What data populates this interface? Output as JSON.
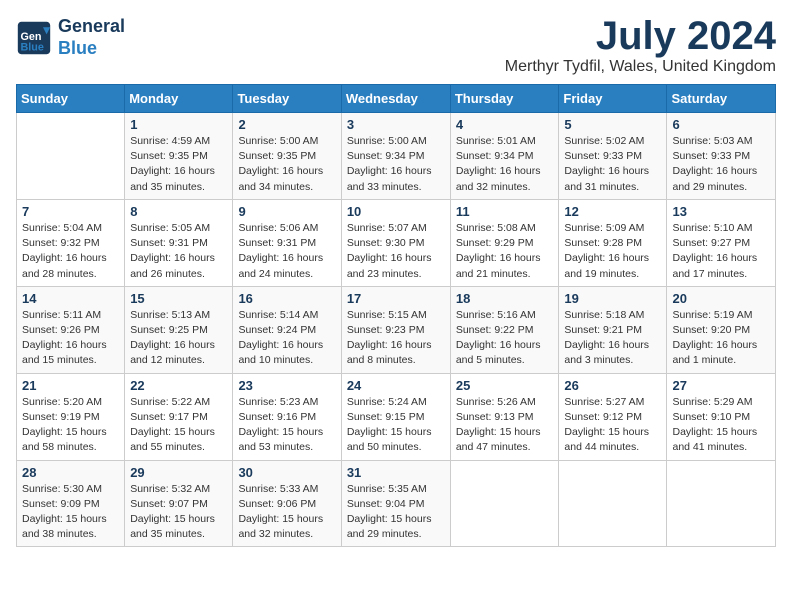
{
  "header": {
    "logo_line1": "General",
    "logo_line2": "Blue",
    "month_title": "July 2024",
    "location": "Merthyr Tydfil, Wales, United Kingdom"
  },
  "days_of_week": [
    "Sunday",
    "Monday",
    "Tuesday",
    "Wednesday",
    "Thursday",
    "Friday",
    "Saturday"
  ],
  "weeks": [
    [
      {
        "num": "",
        "detail": ""
      },
      {
        "num": "1",
        "detail": "Sunrise: 4:59 AM\nSunset: 9:35 PM\nDaylight: 16 hours\nand 35 minutes."
      },
      {
        "num": "2",
        "detail": "Sunrise: 5:00 AM\nSunset: 9:35 PM\nDaylight: 16 hours\nand 34 minutes."
      },
      {
        "num": "3",
        "detail": "Sunrise: 5:00 AM\nSunset: 9:34 PM\nDaylight: 16 hours\nand 33 minutes."
      },
      {
        "num": "4",
        "detail": "Sunrise: 5:01 AM\nSunset: 9:34 PM\nDaylight: 16 hours\nand 32 minutes."
      },
      {
        "num": "5",
        "detail": "Sunrise: 5:02 AM\nSunset: 9:33 PM\nDaylight: 16 hours\nand 31 minutes."
      },
      {
        "num": "6",
        "detail": "Sunrise: 5:03 AM\nSunset: 9:33 PM\nDaylight: 16 hours\nand 29 minutes."
      }
    ],
    [
      {
        "num": "7",
        "detail": "Sunrise: 5:04 AM\nSunset: 9:32 PM\nDaylight: 16 hours\nand 28 minutes."
      },
      {
        "num": "8",
        "detail": "Sunrise: 5:05 AM\nSunset: 9:31 PM\nDaylight: 16 hours\nand 26 minutes."
      },
      {
        "num": "9",
        "detail": "Sunrise: 5:06 AM\nSunset: 9:31 PM\nDaylight: 16 hours\nand 24 minutes."
      },
      {
        "num": "10",
        "detail": "Sunrise: 5:07 AM\nSunset: 9:30 PM\nDaylight: 16 hours\nand 23 minutes."
      },
      {
        "num": "11",
        "detail": "Sunrise: 5:08 AM\nSunset: 9:29 PM\nDaylight: 16 hours\nand 21 minutes."
      },
      {
        "num": "12",
        "detail": "Sunrise: 5:09 AM\nSunset: 9:28 PM\nDaylight: 16 hours\nand 19 minutes."
      },
      {
        "num": "13",
        "detail": "Sunrise: 5:10 AM\nSunset: 9:27 PM\nDaylight: 16 hours\nand 17 minutes."
      }
    ],
    [
      {
        "num": "14",
        "detail": "Sunrise: 5:11 AM\nSunset: 9:26 PM\nDaylight: 16 hours\nand 15 minutes."
      },
      {
        "num": "15",
        "detail": "Sunrise: 5:13 AM\nSunset: 9:25 PM\nDaylight: 16 hours\nand 12 minutes."
      },
      {
        "num": "16",
        "detail": "Sunrise: 5:14 AM\nSunset: 9:24 PM\nDaylight: 16 hours\nand 10 minutes."
      },
      {
        "num": "17",
        "detail": "Sunrise: 5:15 AM\nSunset: 9:23 PM\nDaylight: 16 hours\nand 8 minutes."
      },
      {
        "num": "18",
        "detail": "Sunrise: 5:16 AM\nSunset: 9:22 PM\nDaylight: 16 hours\nand 5 minutes."
      },
      {
        "num": "19",
        "detail": "Sunrise: 5:18 AM\nSunset: 9:21 PM\nDaylight: 16 hours\nand 3 minutes."
      },
      {
        "num": "20",
        "detail": "Sunrise: 5:19 AM\nSunset: 9:20 PM\nDaylight: 16 hours\nand 1 minute."
      }
    ],
    [
      {
        "num": "21",
        "detail": "Sunrise: 5:20 AM\nSunset: 9:19 PM\nDaylight: 15 hours\nand 58 minutes."
      },
      {
        "num": "22",
        "detail": "Sunrise: 5:22 AM\nSunset: 9:17 PM\nDaylight: 15 hours\nand 55 minutes."
      },
      {
        "num": "23",
        "detail": "Sunrise: 5:23 AM\nSunset: 9:16 PM\nDaylight: 15 hours\nand 53 minutes."
      },
      {
        "num": "24",
        "detail": "Sunrise: 5:24 AM\nSunset: 9:15 PM\nDaylight: 15 hours\nand 50 minutes."
      },
      {
        "num": "25",
        "detail": "Sunrise: 5:26 AM\nSunset: 9:13 PM\nDaylight: 15 hours\nand 47 minutes."
      },
      {
        "num": "26",
        "detail": "Sunrise: 5:27 AM\nSunset: 9:12 PM\nDaylight: 15 hours\nand 44 minutes."
      },
      {
        "num": "27",
        "detail": "Sunrise: 5:29 AM\nSunset: 9:10 PM\nDaylight: 15 hours\nand 41 minutes."
      }
    ],
    [
      {
        "num": "28",
        "detail": "Sunrise: 5:30 AM\nSunset: 9:09 PM\nDaylight: 15 hours\nand 38 minutes."
      },
      {
        "num": "29",
        "detail": "Sunrise: 5:32 AM\nSunset: 9:07 PM\nDaylight: 15 hours\nand 35 minutes."
      },
      {
        "num": "30",
        "detail": "Sunrise: 5:33 AM\nSunset: 9:06 PM\nDaylight: 15 hours\nand 32 minutes."
      },
      {
        "num": "31",
        "detail": "Sunrise: 5:35 AM\nSunset: 9:04 PM\nDaylight: 15 hours\nand 29 minutes."
      },
      {
        "num": "",
        "detail": ""
      },
      {
        "num": "",
        "detail": ""
      },
      {
        "num": "",
        "detail": ""
      }
    ]
  ]
}
